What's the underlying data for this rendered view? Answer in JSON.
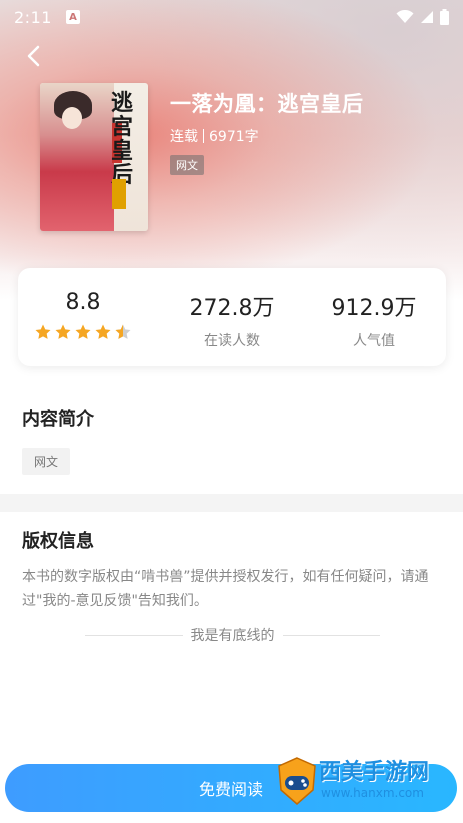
{
  "status_bar": {
    "time": "2:11",
    "notification_glyph": "A",
    "icons": [
      "wifi-icon",
      "signal-icon",
      "battery-icon"
    ]
  },
  "book": {
    "title": "一落为凰：逃宫皇后",
    "status": "连载",
    "word_count": "6971字",
    "tag": "网文",
    "cover_title": "逃宫皇后"
  },
  "stats": {
    "rating": "8.8",
    "rating_stars": 4.5,
    "readers_value": "272.8万",
    "readers_label": "在读人数",
    "popularity_value": "912.9万",
    "popularity_label": "人气值"
  },
  "intro": {
    "heading": "内容简介",
    "chip": "网文"
  },
  "copyright": {
    "heading": "版权信息",
    "text": "本书的数字版权由“啃书兽”提供并授权发行，如有任何疑问，请通过\"我的-意见反馈\"告知我们。",
    "end_text": "我是有底线的"
  },
  "action": {
    "read_button": "免费阅读"
  },
  "watermark": {
    "name": "西美手游网",
    "url": "www.hanxm.com"
  },
  "colors": {
    "accent_blue": "#3e9cff",
    "star": "#f5a623"
  }
}
